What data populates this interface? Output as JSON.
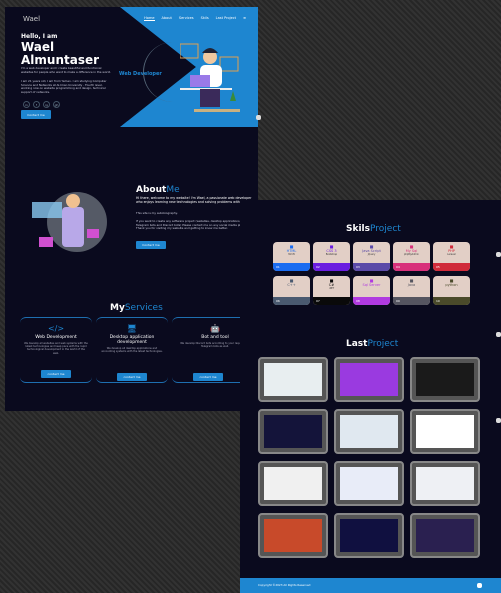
{
  "hero": {
    "logo": "Wael",
    "nav": [
      "Home",
      "About",
      "Services",
      "Skils",
      "Last Project"
    ],
    "greeting": "Hello, I am",
    "name": "Wael Almuntaser",
    "intro1": "I'm a web developer and I create beautiful and functional websites for people who want to make a difference in the world.",
    "intro2": "I am 21 years old, I am from Yemen. I am studying Computer Science and Networks at Al-Iman University - Fourth level, working now on website programming and design, technical support of networks.",
    "social": [
      "in",
      "f",
      "ig",
      "gh"
    ],
    "button": "Contact me",
    "badge": "Web Developer"
  },
  "about": {
    "title_a": "About",
    "title_b": "Me",
    "text1": "Hi there, welcome to my website! I'm Wael, a passionate web developer who enjoys learning new technologies and solving problems with code!",
    "text2": "This site is my autobiography.",
    "text3": "If you want to create any software project (websites, desktop applications, Telegram bots and Discord bots) Please contact me on any social media platform. Thank you for visiting my website and getting to know me better.",
    "button": "Contact me"
  },
  "services": {
    "title_a": "My",
    "title_b": "Services",
    "items": [
      {
        "icon": "code-icon",
        "glyph": "</>",
        "title": "Web Development",
        "desc": "We develop all websites and web systems with the latest technologies and keep pace with the rapid technological development in the world of the web.",
        "button": "contact me"
      },
      {
        "icon": "monitor-icon",
        "glyph": "🖥",
        "title": "Desktop application development",
        "desc": "We develop all desktop applications and accounting systems with the latest technologies.",
        "button": "contact me"
      },
      {
        "icon": "robot-icon",
        "glyph": "🤖",
        "title": "Bot and tool",
        "desc": "We develop Discord bots according to your request and Telegram bots as well.",
        "button": "contact me"
      }
    ]
  },
  "skills": {
    "title_a": "Skils",
    "title_b": "Project",
    "items": [
      {
        "name": "HTML",
        "sub": "html5",
        "num": "01",
        "color": "#1a6cf0"
      },
      {
        "name": "CSS 3",
        "sub": "Bootstrap",
        "num": "02",
        "color": "#6a1de0"
      },
      {
        "name": "Java Script",
        "sub": "jQuery",
        "num": "03",
        "color": "#5a4aa8"
      },
      {
        "name": "My Sql",
        "sub": "phpMyAdmin",
        "num": "04",
        "color": "#d8307a"
      },
      {
        "name": "PHP",
        "sub": "Laravel",
        "num": "05",
        "color": "#d02a3a"
      },
      {
        "name": "C++",
        "sub": "",
        "num": "06",
        "color": "#4a5a70"
      },
      {
        "name": "C#",
        "sub": ".NET",
        "num": "07",
        "color": "#0a0a0a"
      },
      {
        "name": "Sql Server",
        "sub": "",
        "num": "08",
        "color": "#b03ae0"
      },
      {
        "name": "Java",
        "sub": "",
        "num": "09",
        "color": "#555560"
      },
      {
        "name": "python",
        "sub": "",
        "num": "10",
        "color": "#4a4a2a"
      }
    ]
  },
  "projects": {
    "title_a": "Last",
    "title_b": "Project",
    "thumbs": [
      "#e8eef0",
      "#9a3ae0",
      "#1a1a1a",
      "#14143a",
      "#e0e8f0",
      "#ffffff",
      "#f0f0f0",
      "#e8ecf8",
      "#eef0f4",
      "#c84a2a",
      "#101040",
      "#2a2050"
    ]
  },
  "footer": {
    "copyright": "Copyright ©2023 All Rights Reserved"
  }
}
